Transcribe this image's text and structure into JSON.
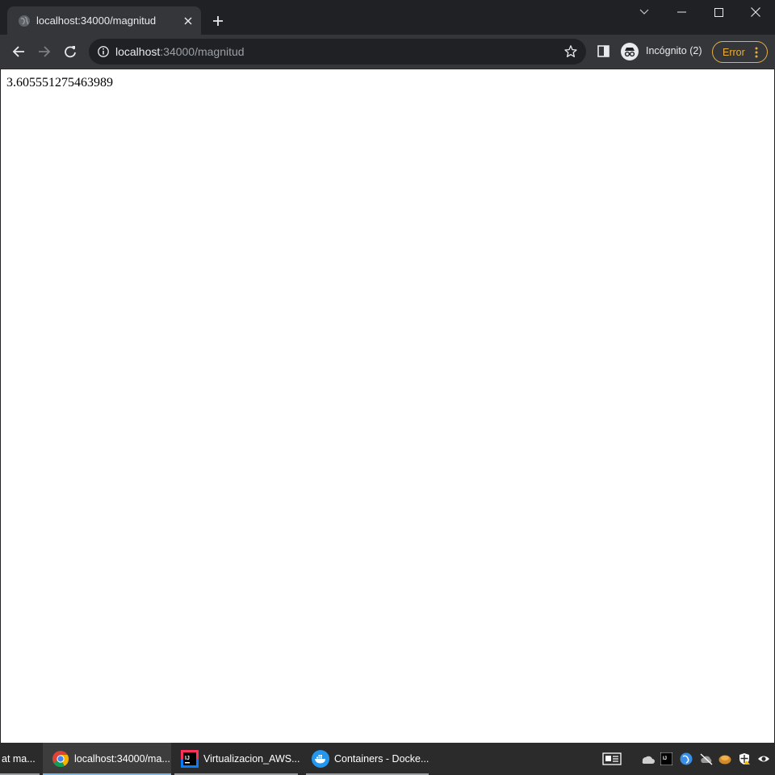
{
  "browser": {
    "tab": {
      "title": "localhost:34000/magnitud",
      "favicon": "globe-icon"
    },
    "omnibox": {
      "host": "localhost",
      "path": ":34000/magnitud"
    },
    "profile": {
      "label": "Incógnito (2)"
    },
    "error_button": {
      "label": "Error"
    }
  },
  "page": {
    "text": "3.605551275463989"
  },
  "taskbar": {
    "items": [
      {
        "label": "at ma...",
        "icon": ""
      },
      {
        "label": "localhost:34000/ma...",
        "icon": "chrome-icon",
        "active": true
      },
      {
        "label": "Virtualizacion_AWS...",
        "icon": "intellij-icon"
      },
      {
        "label": "Containers - Docke...",
        "icon": "docker-icon"
      }
    ]
  },
  "colors": {
    "chrome_dark": "#202124",
    "toolbar": "#35363a",
    "error_accent": "#e8b03d",
    "taskbar": "#2b2b2b",
    "taskbar_active_underline": "#76b9ed"
  }
}
